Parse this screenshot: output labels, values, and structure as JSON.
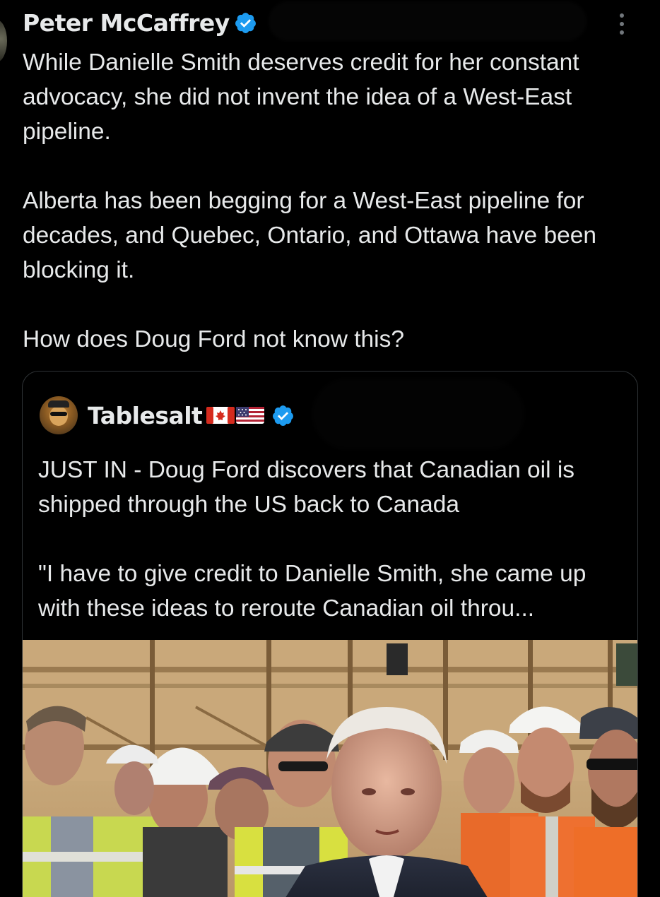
{
  "post": {
    "author_name": "Peter McCaffrey",
    "verified": true,
    "paragraphs": [
      "While Danielle Smith deserves credit for her constant advocacy, she did not invent the idea of a West-East pipeline.",
      "Alberta has been begging for a West-East pipeline for decades, and Quebec, Ontario, and Ottawa have been blocking it.",
      "How does Doug Ford not know this?"
    ]
  },
  "quote": {
    "author_name": "Tablesalt",
    "verified": true,
    "flags": [
      "canada-flag-icon",
      "usa-flag-icon"
    ],
    "paragraphs": [
      "JUST IN - Doug Ford discovers that Canadian oil is shipped through the US back to Canada",
      "\"I have to give credit to Danielle Smith, she came up with these ideas to reroute Canadian oil throu..."
    ]
  },
  "colors": {
    "background": "#000000",
    "text": "#e7e9ea",
    "verified_badge": "#1d9bf0",
    "card_border": "#2f3336",
    "muted": "#71767b"
  }
}
